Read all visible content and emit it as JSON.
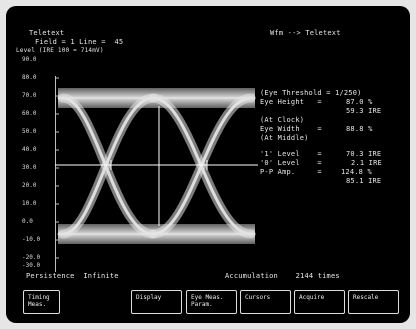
{
  "header": {
    "title": "Teletext",
    "field_line": "Field = 1 Line =  45",
    "level_label": "Level (IRE 100 = 714mV)",
    "mode": "Wfm --> Teletext"
  },
  "y_ticks": [
    "90.0",
    "80.0",
    "70.0",
    "60.0",
    "50.0",
    "40.0",
    "30.0",
    "20.0",
    "10.0",
    "0.0",
    "-10.0",
    "-20.0",
    "-30.0"
  ],
  "measurements": {
    "eye_threshold": "(Eye Threshold = 1/250)",
    "eye_height_label": "Eye Height   =",
    "eye_height_pct": "87.0 %",
    "eye_height_ire": "59.3 IRE",
    "at_clock": "(At Clock)",
    "eye_width_label": "Eye Width    =",
    "eye_width_pct": "88.8 %",
    "at_middle": "(At Middle)",
    "one_level_label": "'1' Level    =",
    "one_level_value": "70.3 IRE",
    "zero_level_label": "'0' Level    =",
    "zero_level_value": "2.1 IRE",
    "pp_amp_label": "P-P Amp.     =",
    "pp_amp_pct": "124.8 %",
    "pp_amp_ire": "85.1 IRE"
  },
  "status": {
    "persistence": "Persistence  Infinite",
    "accumulation": "Accumulation    2144 times"
  },
  "softkeys": {
    "timing": "Timing\nMeas.",
    "display": "Display",
    "eye_meas": "Eye Meas.\nParam.",
    "cursors": "Cursors",
    "acquire": "Acquire",
    "rescale": "Rescale"
  },
  "colors": {
    "screen": "#000000",
    "text": "#e8e8e8",
    "trace": "#d8d8d8",
    "bezel": "#e6e6e6"
  }
}
